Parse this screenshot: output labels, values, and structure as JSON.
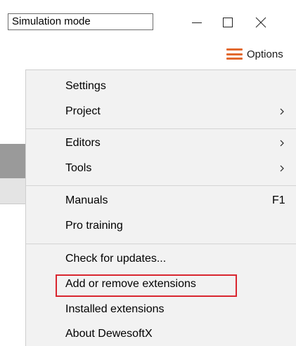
{
  "titlebar": {
    "mode_label": "Simulation mode"
  },
  "window_controls": {
    "minimize_icon": "minimize-icon",
    "maximize_icon": "maximize-icon",
    "close_icon": "close-icon"
  },
  "options": {
    "label": "Options",
    "icon": "hamburger-icon",
    "icon_color": "#e2682d"
  },
  "menu": {
    "items": [
      {
        "label": "Settings",
        "submenu": false,
        "shortcut": ""
      },
      {
        "label": "Project",
        "submenu": true,
        "shortcut": ""
      },
      {
        "label": "Editors",
        "submenu": true,
        "shortcut": ""
      },
      {
        "label": "Tools",
        "submenu": true,
        "shortcut": ""
      },
      {
        "label": "Manuals",
        "submenu": false,
        "shortcut": "F1"
      },
      {
        "label": "Pro training",
        "submenu": false,
        "shortcut": ""
      },
      {
        "label": "Check for updates...",
        "submenu": false,
        "shortcut": ""
      },
      {
        "label": "Add or remove extensions",
        "submenu": false,
        "shortcut": "",
        "highlighted": true
      },
      {
        "label": "Installed extensions",
        "submenu": false,
        "shortcut": ""
      },
      {
        "label": "About DewesoftX",
        "submenu": false,
        "shortcut": ""
      }
    ],
    "highlight_color": "#d9262f"
  }
}
